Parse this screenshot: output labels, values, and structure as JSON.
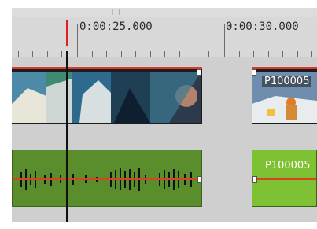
{
  "ruler": {
    "labels": [
      "0:00:25.000",
      "0:00:30.000"
    ]
  },
  "tracks": {
    "video_clip_2_label": "P100005",
    "audio_clip_2_label": "P100005"
  },
  "colors": {
    "playhead_marker": "#e02020",
    "clip_border": "#d63a2c",
    "audio_clip": "#5a8e2c",
    "audio_clip_selected": "#7ec132",
    "gain_line": "#d6451f"
  }
}
